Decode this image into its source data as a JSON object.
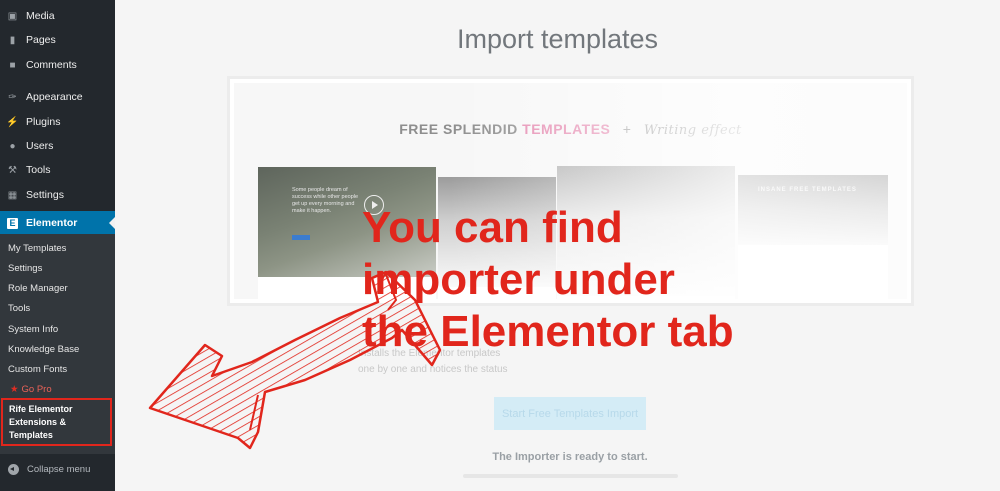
{
  "sidebar": {
    "items": [
      {
        "label": "Media",
        "icon": "media-icon"
      },
      {
        "label": "Pages",
        "icon": "pages-icon"
      },
      {
        "label": "Comments",
        "icon": "comments-icon"
      },
      {
        "label": "Appearance",
        "icon": "appearance-icon"
      },
      {
        "label": "Plugins",
        "icon": "plugins-icon"
      },
      {
        "label": "Users",
        "icon": "users-icon"
      },
      {
        "label": "Tools",
        "icon": "tools-icon"
      },
      {
        "label": "Settings",
        "icon": "settings-icon"
      },
      {
        "label": "Elementor",
        "icon": "elementor-icon"
      }
    ],
    "submenu": [
      "My Templates",
      "Settings",
      "Role Manager",
      "Tools",
      "System Info",
      "Knowledge Base",
      "Custom Fonts",
      "Go Pro"
    ],
    "highlighted_item": "Rife Elementor Extensions & Templates",
    "collapse_label": "Collapse menu"
  },
  "main": {
    "title": "Import templates",
    "preview": {
      "heading_part1": "FREE SPLENDID",
      "heading_part2": "TEMPLATES",
      "heading_plus": "+",
      "heading_script": "Writing effect",
      "card1_text": "Some people dream of success while other people get up every morning and make it happen.",
      "card4_title": "INSANE FREE TEMPLATES"
    },
    "faint_text_line1": "Installs the Elementor templates",
    "faint_text_line2": "one by one and notices the status",
    "start_button_label": "Start Free Templates Import",
    "status_text": "The Importer is ready to start."
  },
  "annotation": {
    "callout_line1": "You can find",
    "callout_line2": "importer under",
    "callout_line3": "the Elementor tab"
  },
  "colors": {
    "sidebar_bg": "#23282d",
    "submenu_bg": "#32373c",
    "active_item": "#0073aa",
    "annotation_red": "#e1261c",
    "templates_pink": "#e58ab0"
  }
}
